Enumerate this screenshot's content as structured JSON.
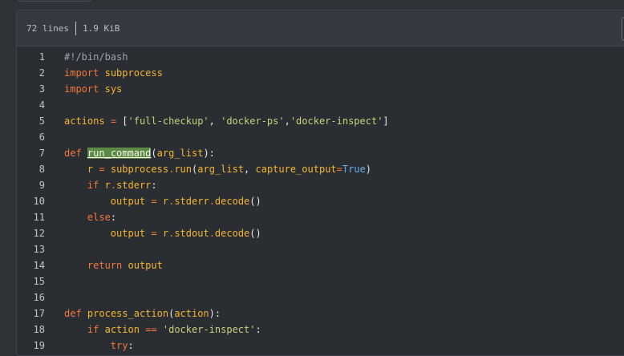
{
  "file_info": {
    "lines": "72 lines",
    "size": "1.9 KiB"
  },
  "code": [
    {
      "n": "1",
      "tokens": [
        {
          "t": "#!/bin/bash",
          "c": "cm"
        }
      ]
    },
    {
      "n": "2",
      "tokens": [
        {
          "t": "import",
          "c": "kw"
        },
        {
          "t": " ",
          "c": "src"
        },
        {
          "t": "subprocess",
          "c": "nm"
        }
      ]
    },
    {
      "n": "3",
      "tokens": [
        {
          "t": "import",
          "c": "kw"
        },
        {
          "t": " ",
          "c": "src"
        },
        {
          "t": "sys",
          "c": "nm"
        }
      ]
    },
    {
      "n": "4",
      "tokens": []
    },
    {
      "n": "5",
      "tokens": [
        {
          "t": "actions",
          "c": "nm"
        },
        {
          "t": " ",
          "c": "src"
        },
        {
          "t": "=",
          "c": "op"
        },
        {
          "t": " [",
          "c": "src"
        },
        {
          "t": "'full-checkup'",
          "c": "str"
        },
        {
          "t": ", ",
          "c": "src"
        },
        {
          "t": "'docker-ps'",
          "c": "str"
        },
        {
          "t": ",",
          "c": "src"
        },
        {
          "t": "'docker-inspect'",
          "c": "str"
        },
        {
          "t": "]",
          "c": "src"
        }
      ]
    },
    {
      "n": "6",
      "tokens": []
    },
    {
      "n": "7",
      "tokens": [
        {
          "t": "def",
          "c": "kw"
        },
        {
          "t": " ",
          "c": "src"
        },
        {
          "t": "run_command",
          "c": "hl"
        },
        {
          "t": "(",
          "c": "src"
        },
        {
          "t": "arg_list",
          "c": "nm"
        },
        {
          "t": "):",
          "c": "src"
        }
      ]
    },
    {
      "n": "8",
      "tokens": [
        {
          "t": "    ",
          "c": "src"
        },
        {
          "t": "r",
          "c": "nm"
        },
        {
          "t": " ",
          "c": "src"
        },
        {
          "t": "=",
          "c": "op"
        },
        {
          "t": " ",
          "c": "src"
        },
        {
          "t": "subprocess",
          "c": "nm"
        },
        {
          "t": ".",
          "c": "op"
        },
        {
          "t": "run",
          "c": "nm"
        },
        {
          "t": "(",
          "c": "src"
        },
        {
          "t": "arg_list",
          "c": "nm"
        },
        {
          "t": ", ",
          "c": "src"
        },
        {
          "t": "capture_output",
          "c": "nm"
        },
        {
          "t": "=",
          "c": "op"
        },
        {
          "t": "True",
          "c": "bool"
        },
        {
          "t": ")",
          "c": "src"
        }
      ]
    },
    {
      "n": "9",
      "tokens": [
        {
          "t": "    ",
          "c": "src"
        },
        {
          "t": "if",
          "c": "kw"
        },
        {
          "t": " ",
          "c": "src"
        },
        {
          "t": "r",
          "c": "nm"
        },
        {
          "t": ".",
          "c": "op"
        },
        {
          "t": "stderr",
          "c": "nm"
        },
        {
          "t": ":",
          "c": "src"
        }
      ]
    },
    {
      "n": "10",
      "tokens": [
        {
          "t": "        ",
          "c": "src"
        },
        {
          "t": "output",
          "c": "nm"
        },
        {
          "t": " ",
          "c": "src"
        },
        {
          "t": "=",
          "c": "op"
        },
        {
          "t": " ",
          "c": "src"
        },
        {
          "t": "r",
          "c": "nm"
        },
        {
          "t": ".",
          "c": "op"
        },
        {
          "t": "stderr",
          "c": "nm"
        },
        {
          "t": ".",
          "c": "op"
        },
        {
          "t": "decode",
          "c": "nm"
        },
        {
          "t": "()",
          "c": "src"
        }
      ]
    },
    {
      "n": "11",
      "tokens": [
        {
          "t": "    ",
          "c": "src"
        },
        {
          "t": "else",
          "c": "kw"
        },
        {
          "t": ":",
          "c": "src"
        }
      ]
    },
    {
      "n": "12",
      "tokens": [
        {
          "t": "        ",
          "c": "src"
        },
        {
          "t": "output",
          "c": "nm"
        },
        {
          "t": " ",
          "c": "src"
        },
        {
          "t": "=",
          "c": "op"
        },
        {
          "t": " ",
          "c": "src"
        },
        {
          "t": "r",
          "c": "nm"
        },
        {
          "t": ".",
          "c": "op"
        },
        {
          "t": "stdout",
          "c": "nm"
        },
        {
          "t": ".",
          "c": "op"
        },
        {
          "t": "decode",
          "c": "nm"
        },
        {
          "t": "()",
          "c": "src"
        }
      ]
    },
    {
      "n": "13",
      "tokens": []
    },
    {
      "n": "14",
      "tokens": [
        {
          "t": "    ",
          "c": "src"
        },
        {
          "t": "return",
          "c": "kw"
        },
        {
          "t": " ",
          "c": "src"
        },
        {
          "t": "output",
          "c": "nm"
        }
      ]
    },
    {
      "n": "15",
      "tokens": []
    },
    {
      "n": "16",
      "tokens": []
    },
    {
      "n": "17",
      "tokens": [
        {
          "t": "def",
          "c": "kw"
        },
        {
          "t": " ",
          "c": "src"
        },
        {
          "t": "process_action",
          "c": "nm"
        },
        {
          "t": "(",
          "c": "src"
        },
        {
          "t": "action",
          "c": "nm"
        },
        {
          "t": "):",
          "c": "src"
        }
      ]
    },
    {
      "n": "18",
      "tokens": [
        {
          "t": "    ",
          "c": "src"
        },
        {
          "t": "if",
          "c": "kw"
        },
        {
          "t": " ",
          "c": "src"
        },
        {
          "t": "action",
          "c": "nm"
        },
        {
          "t": " ",
          "c": "src"
        },
        {
          "t": "==",
          "c": "op"
        },
        {
          "t": " ",
          "c": "src"
        },
        {
          "t": "'docker-inspect'",
          "c": "str"
        },
        {
          "t": ":",
          "c": "src"
        }
      ]
    },
    {
      "n": "19",
      "tokens": [
        {
          "t": "        ",
          "c": "src"
        },
        {
          "t": "try",
          "c": "kw"
        },
        {
          "t": ":",
          "c": "src"
        }
      ]
    }
  ]
}
